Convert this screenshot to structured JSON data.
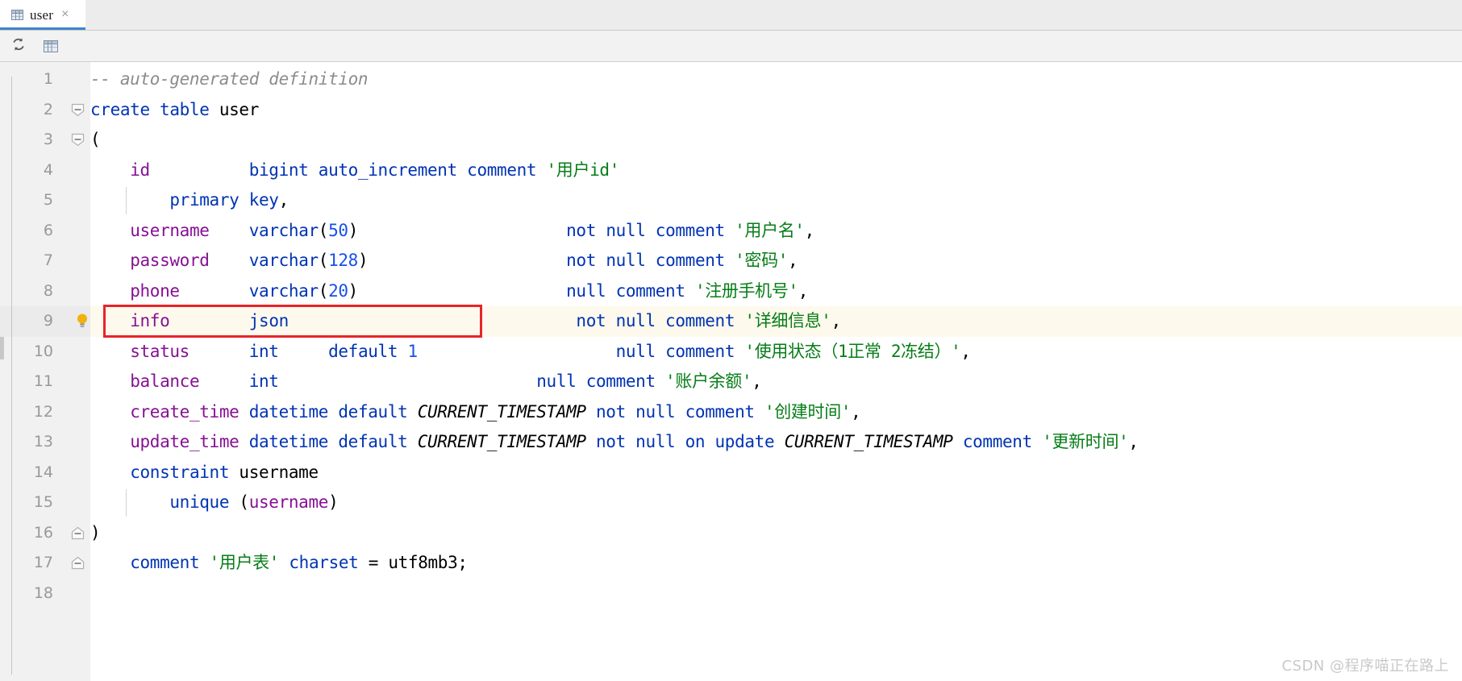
{
  "window": {
    "title": "user"
  },
  "tab": {
    "label": "user",
    "close_label": "×",
    "icon": "table-grid-icon",
    "accent_color": "#4083c9"
  },
  "toolbar": {
    "buttons": [
      {
        "name": "refresh-button",
        "icon": "refresh-icon",
        "title": "Refresh"
      },
      {
        "name": "table-view-button",
        "icon": "table-grid-icon",
        "title": "Table"
      }
    ]
  },
  "editor": {
    "highlighted_line": 9,
    "bulb_line": 9,
    "fold_lines": [
      2,
      3,
      16,
      17
    ],
    "line_numbers": [
      "1",
      "2",
      "3",
      "4",
      "5",
      "6",
      "7",
      "8",
      "9",
      "10",
      "11",
      "12",
      "13",
      "14",
      "15",
      "16",
      "17",
      "18"
    ],
    "lines": [
      {
        "n": "1",
        "tokens": [
          {
            "t": "-- auto-generated definition",
            "c": "cmt"
          }
        ]
      },
      {
        "n": "2",
        "tokens": [
          {
            "t": "create table ",
            "c": "kw"
          },
          {
            "t": "user",
            "c": "pl"
          }
        ]
      },
      {
        "n": "3",
        "tokens": [
          {
            "t": "(",
            "c": "pl"
          }
        ]
      },
      {
        "n": "4",
        "tokens": [
          {
            "t": "    ",
            "c": "pl"
          },
          {
            "t": "id",
            "c": "col"
          },
          {
            "t": "          ",
            "c": "pl"
          },
          {
            "t": "bigint auto_increment comment ",
            "c": "kw"
          },
          {
            "t": "'用户id'",
            "c": "str"
          }
        ]
      },
      {
        "n": "5",
        "tokens": [
          {
            "t": "        ",
            "c": "pl"
          },
          {
            "t": "primary key",
            "c": "kw"
          },
          {
            "t": ",",
            "c": "pl"
          }
        ]
      },
      {
        "n": "6",
        "tokens": [
          {
            "t": "    ",
            "c": "pl"
          },
          {
            "t": "username",
            "c": "col"
          },
          {
            "t": "    ",
            "c": "pl"
          },
          {
            "t": "varchar",
            "c": "kw"
          },
          {
            "t": "(",
            "c": "pl"
          },
          {
            "t": "50",
            "c": "num"
          },
          {
            "t": ")",
            "c": "pl"
          },
          {
            "t": "                     ",
            "c": "pl"
          },
          {
            "t": "not null comment ",
            "c": "kw"
          },
          {
            "t": "'用户名'",
            "c": "str"
          },
          {
            "t": ",",
            "c": "pl"
          }
        ]
      },
      {
        "n": "7",
        "tokens": [
          {
            "t": "    ",
            "c": "pl"
          },
          {
            "t": "password",
            "c": "col"
          },
          {
            "t": "    ",
            "c": "pl"
          },
          {
            "t": "varchar",
            "c": "kw"
          },
          {
            "t": "(",
            "c": "pl"
          },
          {
            "t": "128",
            "c": "num"
          },
          {
            "t": ")",
            "c": "pl"
          },
          {
            "t": "                    ",
            "c": "pl"
          },
          {
            "t": "not null comment ",
            "c": "kw"
          },
          {
            "t": "'密码'",
            "c": "str"
          },
          {
            "t": ",",
            "c": "pl"
          }
        ]
      },
      {
        "n": "8",
        "tokens": [
          {
            "t": "    ",
            "c": "pl"
          },
          {
            "t": "phone",
            "c": "col"
          },
          {
            "t": "       ",
            "c": "pl"
          },
          {
            "t": "varchar",
            "c": "kw"
          },
          {
            "t": "(",
            "c": "pl"
          },
          {
            "t": "20",
            "c": "num"
          },
          {
            "t": ")",
            "c": "pl"
          },
          {
            "t": "                     ",
            "c": "pl"
          },
          {
            "t": "null comment ",
            "c": "kw"
          },
          {
            "t": "'注册手机号'",
            "c": "str"
          },
          {
            "t": ",",
            "c": "pl"
          }
        ]
      },
      {
        "n": "9",
        "tokens": [
          {
            "t": "    ",
            "c": "pl"
          },
          {
            "t": "info",
            "c": "col"
          },
          {
            "t": "        ",
            "c": "pl"
          },
          {
            "t": "json",
            "c": "kw"
          },
          {
            "t": "                             ",
            "c": "pl"
          },
          {
            "t": "not null comment ",
            "c": "kw"
          },
          {
            "t": "'详细信息'",
            "c": "str"
          },
          {
            "t": ",",
            "c": "pl"
          }
        ]
      },
      {
        "n": "10",
        "tokens": [
          {
            "t": "    ",
            "c": "pl"
          },
          {
            "t": "status",
            "c": "col"
          },
          {
            "t": "      ",
            "c": "pl"
          },
          {
            "t": "int",
            "c": "kw"
          },
          {
            "t": "     ",
            "c": "pl"
          },
          {
            "t": "default ",
            "c": "kw"
          },
          {
            "t": "1",
            "c": "num"
          },
          {
            "t": "                    ",
            "c": "pl"
          },
          {
            "t": "null comment ",
            "c": "kw"
          },
          {
            "t": "'使用状态（1正常 2冻结）'",
            "c": "str"
          },
          {
            "t": ",",
            "c": "pl"
          }
        ]
      },
      {
        "n": "11",
        "tokens": [
          {
            "t": "    ",
            "c": "pl"
          },
          {
            "t": "balance",
            "c": "col"
          },
          {
            "t": "     ",
            "c": "pl"
          },
          {
            "t": "int",
            "c": "kw"
          },
          {
            "t": "                          ",
            "c": "pl"
          },
          {
            "t": "null comment ",
            "c": "kw"
          },
          {
            "t": "'账户余额'",
            "c": "str"
          },
          {
            "t": ",",
            "c": "pl"
          }
        ]
      },
      {
        "n": "12",
        "tokens": [
          {
            "t": "    ",
            "c": "pl"
          },
          {
            "t": "create_time",
            "c": "col"
          },
          {
            "t": " ",
            "c": "pl"
          },
          {
            "t": "datetime default ",
            "c": "kw"
          },
          {
            "t": "CURRENT_TIMESTAMP",
            "c": "cst"
          },
          {
            "t": " ",
            "c": "pl"
          },
          {
            "t": "not null comment ",
            "c": "kw"
          },
          {
            "t": "'创建时间'",
            "c": "str"
          },
          {
            "t": ",",
            "c": "pl"
          }
        ]
      },
      {
        "n": "13",
        "tokens": [
          {
            "t": "    ",
            "c": "pl"
          },
          {
            "t": "update_time",
            "c": "col"
          },
          {
            "t": " ",
            "c": "pl"
          },
          {
            "t": "datetime default ",
            "c": "kw"
          },
          {
            "t": "CURRENT_TIMESTAMP",
            "c": "cst"
          },
          {
            "t": " ",
            "c": "pl"
          },
          {
            "t": "not null on update ",
            "c": "kw"
          },
          {
            "t": "CURRENT_TIMESTAMP",
            "c": "cst"
          },
          {
            "t": " ",
            "c": "pl"
          },
          {
            "t": "comment ",
            "c": "kw"
          },
          {
            "t": "'更新时间'",
            "c": "str"
          },
          {
            "t": ",",
            "c": "pl"
          }
        ]
      },
      {
        "n": "14",
        "tokens": [
          {
            "t": "    ",
            "c": "pl"
          },
          {
            "t": "constraint ",
            "c": "kw"
          },
          {
            "t": "username",
            "c": "pl"
          }
        ]
      },
      {
        "n": "15",
        "tokens": [
          {
            "t": "        ",
            "c": "pl"
          },
          {
            "t": "unique ",
            "c": "kw"
          },
          {
            "t": "(",
            "c": "pl"
          },
          {
            "t": "username",
            "c": "col"
          },
          {
            "t": ")",
            "c": "pl"
          }
        ]
      },
      {
        "n": "16",
        "tokens": [
          {
            "t": ")",
            "c": "pl"
          }
        ]
      },
      {
        "n": "17",
        "tokens": [
          {
            "t": "    ",
            "c": "pl"
          },
          {
            "t": "comment ",
            "c": "kw"
          },
          {
            "t": "'用户表'",
            "c": "str"
          },
          {
            "t": " ",
            "c": "pl"
          },
          {
            "t": "charset ",
            "c": "kw"
          },
          {
            "t": "= ",
            "c": "pl"
          },
          {
            "t": "utf8mb3",
            "c": "pl"
          },
          {
            "t": ";",
            "c": "pl"
          }
        ]
      },
      {
        "n": "18",
        "tokens": []
      }
    ]
  },
  "annotation": {
    "type": "red-rectangle",
    "color": "#e8242a",
    "targets_line": 9,
    "covers_text": "info        json"
  },
  "watermark": {
    "text": "CSDN @程序喵正在路上"
  },
  "colors": {
    "keyword": "#0033b3",
    "column": "#871094",
    "string": "#067d17",
    "number": "#1750eb",
    "comment": "#8c8c8c",
    "constant": "#000000",
    "highlight_line_bg": "#fdf9ec",
    "gutter_bg": "#f1f1f1",
    "tab_accent": "#4083c9"
  }
}
